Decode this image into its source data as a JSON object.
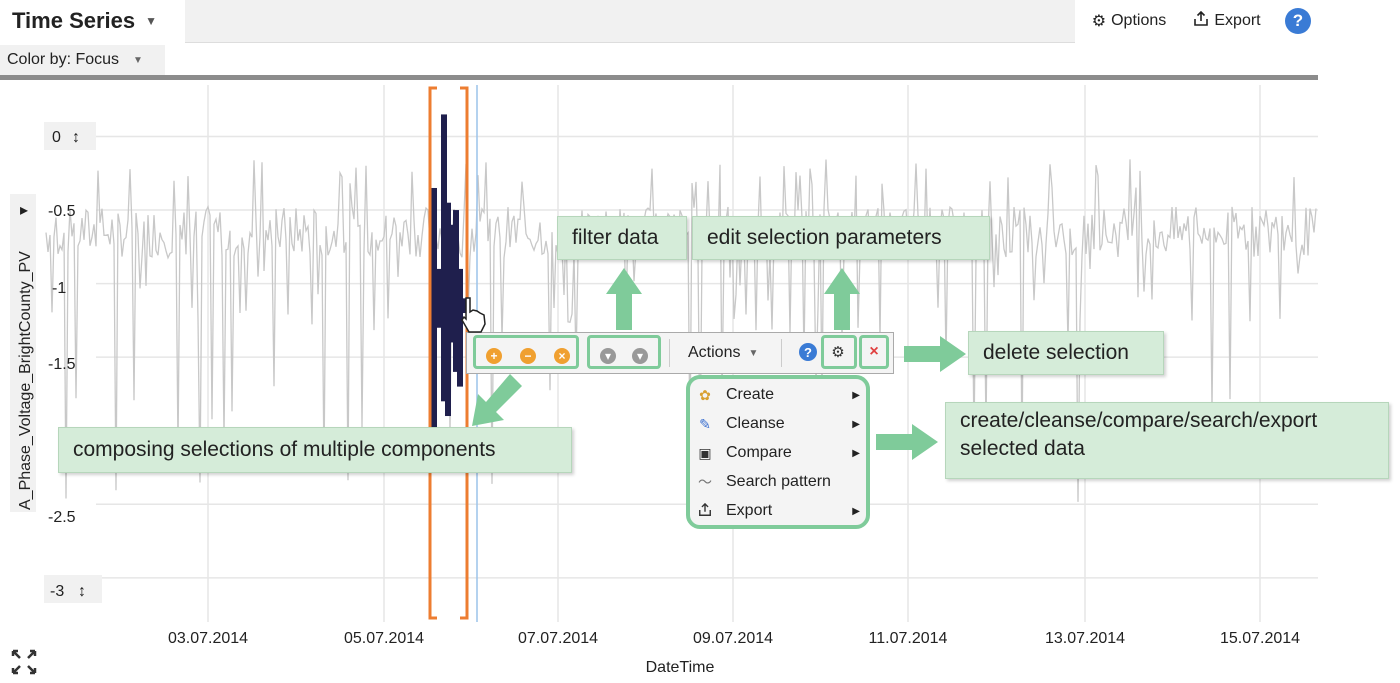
{
  "header": {
    "title": "Time Series",
    "options_label": "Options",
    "export_label": "Export",
    "help_label": "?"
  },
  "colorby": {
    "label": "Color by: Focus"
  },
  "axis": {
    "ylabel": "A_Phase_Voltage_BrightCounty_PV",
    "xlabel": "DateTime",
    "y_ticks": [
      "0",
      "-0.5",
      "-1",
      "-1.5",
      "-2.5",
      "-3"
    ],
    "y_tick_values": [
      0,
      -0.5,
      -1,
      -1.5,
      -2.5,
      -3
    ],
    "x_ticks": [
      "03.07.2014",
      "05.07.2014",
      "07.07.2014",
      "09.07.2014",
      "11.07.2014",
      "13.07.2014",
      "15.07.2014"
    ],
    "ylim": [
      -3.3,
      0.35
    ]
  },
  "toolbar": {
    "actions_label": "Actions"
  },
  "menu": {
    "items": [
      {
        "label": "Create",
        "icon": "create-icon"
      },
      {
        "label": "Cleanse",
        "icon": "cleanse-icon"
      },
      {
        "label": "Compare",
        "icon": "compare-icon"
      },
      {
        "label": "Search pattern",
        "icon": "search-pattern-icon"
      },
      {
        "label": "Export",
        "icon": "export-icon"
      }
    ]
  },
  "callouts": {
    "filter": "filter data",
    "edit": "edit selection parameters",
    "delete": "delete selection",
    "compose": "composing selections of multiple components",
    "create_line1": "create/cleanse/compare/search/export",
    "create_line2": "selected data"
  },
  "colors": {
    "accent": "#7fcb9a",
    "callout_bg": "#d5ecd9",
    "selection_bracket": "#ed7d31",
    "series_gray": "#c8c8c8",
    "selected_series": "#1f1f4d",
    "help_blue": "#3a7bd5"
  }
}
